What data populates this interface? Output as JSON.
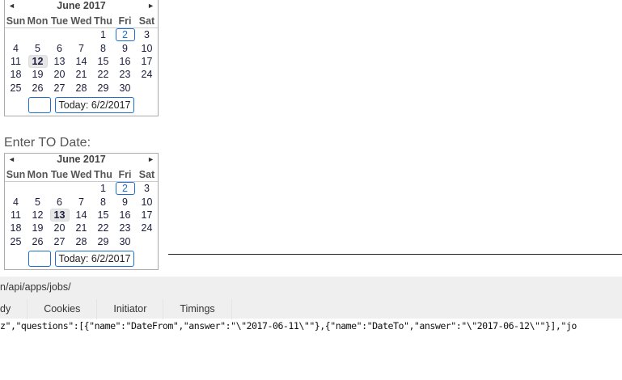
{
  "calendars": [
    {
      "month": "June 2017",
      "prev": "◄",
      "next": "►",
      "days_of_week": [
        "Sun",
        "Mon",
        "Tue",
        "Wed",
        "Thu",
        "Fri",
        "Sat"
      ],
      "weeks": [
        [
          "",
          "",
          "",
          "",
          "1",
          "2",
          "3"
        ],
        [
          "4",
          "5",
          "6",
          "7",
          "8",
          "9",
          "10"
        ],
        [
          "11",
          "12",
          "13",
          "14",
          "15",
          "16",
          "17"
        ],
        [
          "18",
          "19",
          "20",
          "21",
          "22",
          "23",
          "24"
        ],
        [
          "25",
          "26",
          "27",
          "28",
          "29",
          "30",
          ""
        ]
      ],
      "today": "2",
      "selected": "12",
      "blank_button": "",
      "today_button": "Today: 6/2/2017"
    },
    {
      "month": "June 2017",
      "prev": "◄",
      "next": "►",
      "days_of_week": [
        "Sun",
        "Mon",
        "Tue",
        "Wed",
        "Thu",
        "Fri",
        "Sat"
      ],
      "weeks": [
        [
          "",
          "",
          "",
          "",
          "1",
          "2",
          "3"
        ],
        [
          "4",
          "5",
          "6",
          "7",
          "8",
          "9",
          "10"
        ],
        [
          "11",
          "12",
          "13",
          "14",
          "15",
          "16",
          "17"
        ],
        [
          "18",
          "19",
          "20",
          "21",
          "22",
          "23",
          "24"
        ],
        [
          "25",
          "26",
          "27",
          "28",
          "29",
          "30",
          ""
        ]
      ],
      "today": "2",
      "selected": "13",
      "blank_button": "",
      "today_button": "Today: 6/2/2017"
    }
  ],
  "to_label": "Enter TO Date:",
  "devtools": {
    "url": "n/api/apps/jobs/",
    "tabs": [
      "dy",
      "Cookies",
      "Initiator",
      "Timings"
    ],
    "body": "z\",\"questions\":[{\"name\":\"DateFrom\",\"answer\":\"\\\"2017-06-11\\\"\"},{\"name\":\"DateTo\",\"answer\":\"\\\"2017-06-12\\\"\"}],\"jo"
  }
}
